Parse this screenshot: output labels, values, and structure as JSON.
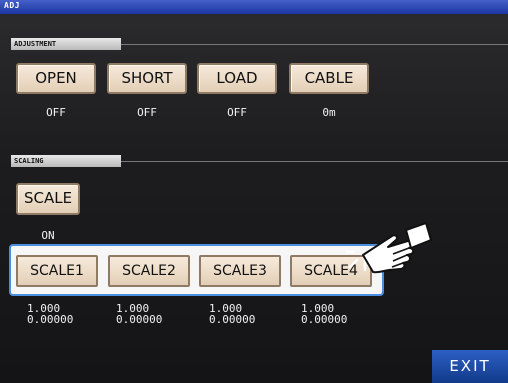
{
  "window": {
    "title": "ADJ"
  },
  "adjustment": {
    "section_label": "ADJUSTMENT",
    "buttons": [
      {
        "label": "OPEN",
        "status": "OFF"
      },
      {
        "label": "SHORT",
        "status": "OFF"
      },
      {
        "label": "LOAD",
        "status": "OFF"
      },
      {
        "label": "CABLE",
        "status": "0m"
      }
    ]
  },
  "scaling": {
    "section_label": "SCALING",
    "scale_button": {
      "label": "SCALE",
      "status": "ON"
    },
    "scale_buttons": [
      {
        "label": "SCALE1",
        "value_a": "1.000",
        "value_b": "0.00000"
      },
      {
        "label": "SCALE2",
        "value_a": "1.000",
        "value_b": "0.00000"
      },
      {
        "label": "SCALE3",
        "value_a": "1.000",
        "value_b": "0.00000"
      },
      {
        "label": "SCALE4",
        "value_a": "1.000",
        "value_b": "0.00000"
      }
    ]
  },
  "footer": {
    "exit_label": "EXIT"
  },
  "colors": {
    "title_bar": "#1d35a2",
    "button_face": "#efe0cc",
    "highlight_border": "#4a8ee0",
    "exit_button": "#1f4ea8"
  },
  "icons": {
    "pointer": "hand-pointer-icon"
  }
}
